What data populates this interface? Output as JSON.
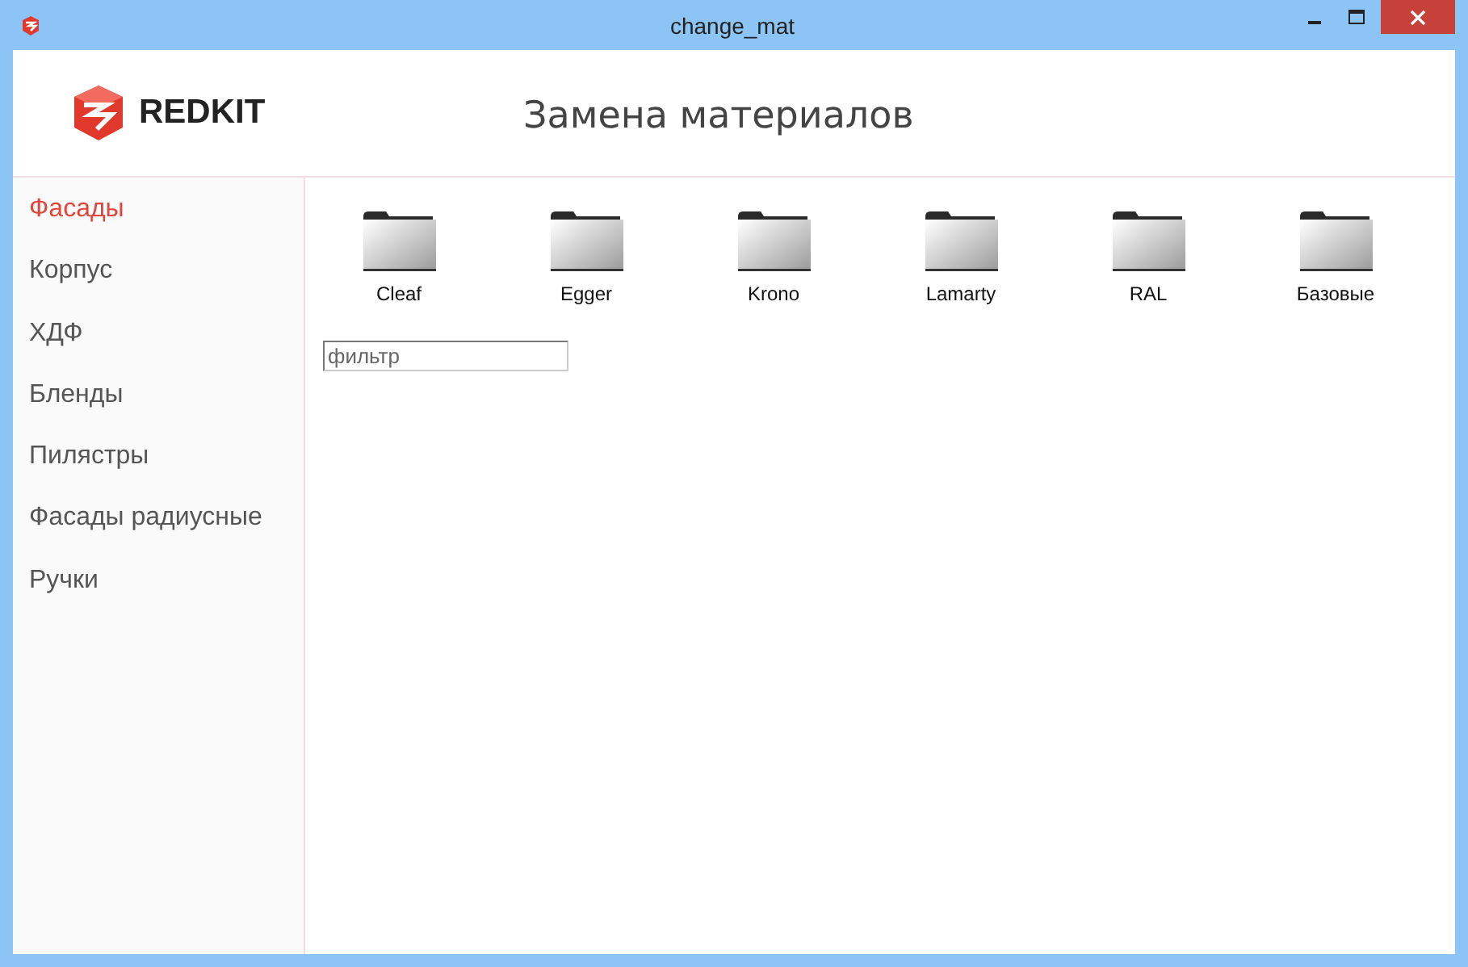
{
  "window": {
    "title": "change_mat"
  },
  "header": {
    "logo": "REDKIT",
    "title": "Замена материалов"
  },
  "sidebar": {
    "items": [
      {
        "label": "Фасады",
        "selected": true
      },
      {
        "label": "Корпус",
        "selected": false
      },
      {
        "label": "ХДФ",
        "selected": false
      },
      {
        "label": "Бленды",
        "selected": false
      },
      {
        "label": "Пилястры",
        "selected": false
      },
      {
        "label": "Фасады радиусные",
        "selected": false
      },
      {
        "label": "Ручки",
        "selected": false
      }
    ]
  },
  "folders": [
    {
      "label": "Cleaf"
    },
    {
      "label": "Egger"
    },
    {
      "label": "Krono"
    },
    {
      "label": "Lamarty"
    },
    {
      "label": "RAL"
    },
    {
      "label": "Базовые"
    }
  ],
  "filter": {
    "placeholder": "фильтр"
  }
}
